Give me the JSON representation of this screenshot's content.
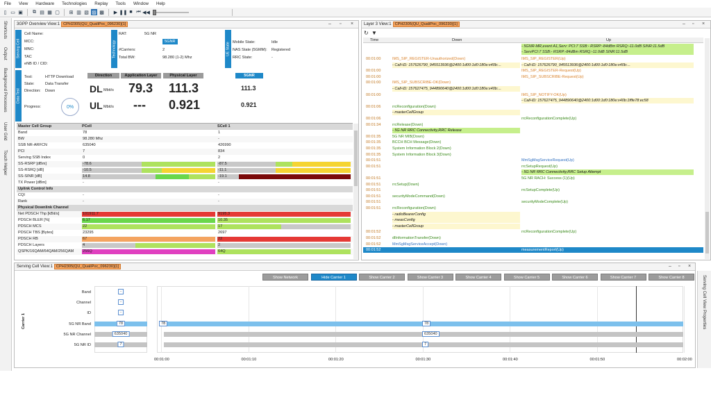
{
  "menu": [
    "File",
    "View",
    "Hardware",
    "Technologies",
    "Replay",
    "Tools",
    "Window",
    "Help"
  ],
  "side_tabs": [
    "Shortcuts",
    "Output",
    "Background Processes",
    "User Grid",
    "Touch Helper"
  ],
  "right_side_tab": "Serving Cell View Properties",
  "overview": {
    "title": "3GPP Overview View:1",
    "tag": "CPH2305(QU_QualiPoc_096230)[1]",
    "bands": {
      "serving_cell": "Serving Cell",
      "technology": "Technology",
      "ue_state": "UE State",
      "data_test": "Data Test"
    },
    "cell_labels": [
      "Cell Name:",
      "MCC:",
      "MNC:",
      "TAC",
      "eNB ID / CID:"
    ],
    "rat_label": "RAT:",
    "rat_value": "5G NR",
    "sgnr_badge": "5GNR",
    "carriers_label": "#Carriers:",
    "carriers_value": "2",
    "bw_label": "Total BW:",
    "bw_value": "98.280 (1-2) Mhz",
    "mobile_label": "Mobile State:",
    "mobile_value": "Idle",
    "nas_label": "NAS State (5GMM):",
    "nas_value": "Registered",
    "rrc_label": "RRC State:",
    "rrc_value": "-",
    "test_label": "Test:",
    "test_value": "HTTP Download",
    "state_label": "State:",
    "state_value": "Data Transfer",
    "direction_label": "Direction:",
    "direction_value": "Down",
    "progress_label": "Progress:",
    "progress_value": "0%",
    "col_direction": "Direction",
    "col_app": "Application Layer",
    "col_phy": "Physical Layer",
    "col_5gnr": "5GNR",
    "dl": "DL",
    "ul": "UL",
    "unit": "Mbit/s",
    "dl_app": "79.3",
    "dl_phy": "111.3",
    "dl_5gnr": "111.3",
    "ul_app": "---",
    "ul_phy": "0.921",
    "ul_5gnr": "0.921"
  },
  "table": {
    "col_group": "Master Cell Group",
    "col_pcell": "PCell",
    "col_scell": "SCell 1",
    "rows": [
      {
        "label": "Band",
        "p": "78",
        "s": "1"
      },
      {
        "label": "BW",
        "p": "98.280 Mhz",
        "s": "-"
      },
      {
        "label": "SSB NR-ARFCN",
        "p": "635040",
        "s": "426990"
      },
      {
        "label": "PCI",
        "p": "7",
        "s": "834"
      },
      {
        "label": "Serving SSB Index",
        "p": "0",
        "s": "2"
      },
      {
        "label": "SS-RSRP [dBm]",
        "p": "-78.6",
        "s": "-87.5"
      },
      {
        "label": "SS-RSRQ [dB]",
        "p": "-10.5",
        "s": "-11.1"
      },
      {
        "label": "SS-SINR [dB]",
        "p": "14.8",
        "s": "-19.1"
      },
      {
        "label": "TX Power [dBm]",
        "p": "-",
        "s": "-"
      },
      {
        "label": "Uplink Control Info",
        "section": true
      },
      {
        "label": "CQI",
        "p": "-",
        "s": "-"
      },
      {
        "label": "Rank",
        "p": "-",
        "s": "-"
      },
      {
        "label": "Physical Downlink Channel",
        "section": true
      },
      {
        "label": "Net PDSCH Thp [kBit/s]",
        "p": "101911.7",
        "s": "9195.3"
      },
      {
        "label": "PDSCH BLER [%]",
        "p": "6.17",
        "s": "10.35"
      },
      {
        "label": "PDSCH MCS",
        "p": "22",
        "s": "17"
      },
      {
        "label": "PDSCH TBS [Bytes]",
        "p": "23295",
        "s": "2697"
      },
      {
        "label": "PDSCH RB",
        "p": "67",
        "s": "22"
      },
      {
        "label": "PDSCH Layers",
        "p": "4",
        "s": "2"
      },
      {
        "label": "QSPK/16QAM/64QAM/256QAM",
        "p": "256Q",
        "s": "64Q"
      }
    ]
  },
  "layer3": {
    "title": "Layer 3 View:1",
    "tag": "CPH2305(QU_QualiPoc_096230)[1]",
    "col_time": "Time",
    "col_down": "Down",
    "col_up": "Up",
    "top_up_1": "- 5GNR-MR,event A1,Serv: PCI:7 SSB:- RSRP:-84dBm RSRQ:-11.0dB SINR:11.5dB",
    "top_up_2": "- ServPCI:7 SSB:- RSRP:-84dBm RSRQ:-11.0dB SINR:11.5dB",
    "rows": [
      {
        "time": "00:01:00",
        "down": "IMS_SIP_REGISTER-Unauthorized(Down)",
        "up": "IMS_SIP_REGISTER(Up)",
        "kind": "ims"
      },
      {
        "time": "",
        "down": "- Call-ID: 157626790_945513936@2400:1d00:1d0:180e:x40b:...",
        "up": "- Call-ID: 157626790_945513936@2400:1d00:1d0:180e:x40b:...",
        "kind": "ims-detail"
      },
      {
        "time": "00:01:00",
        "down": "",
        "up": "IMS_SIP_REGISTER-Request(Up)",
        "kind": "ims"
      },
      {
        "time": "00:01:00",
        "down": "",
        "up": "IMS_SIP_SUBSCRIBE-Request(Up)",
        "kind": "ims"
      },
      {
        "time": "00:01:00",
        "down": "IMS_SIP_SUBSCRIBE-OK(Down)",
        "up": "",
        "kind": "ims"
      },
      {
        "time": "",
        "down": "- Call-ID: 157627475_944890640@2400:1d00:1d0:180e:x40b:...",
        "up": "",
        "kind": "ims-detail"
      },
      {
        "time": "00:01:00",
        "down": "",
        "up": "IMS_SIP_NOTIFY-OK(Up)",
        "kind": "ims"
      },
      {
        "time": "",
        "down": "",
        "up": "- Call-ID: 157627475_944890640@2400:1d00:1d0:180e:x40b:1fffe78:ec58",
        "kind": "ims-detail"
      },
      {
        "time": "00:01:06",
        "down": "rrcReconfiguration(Down)",
        "up": "",
        "kind": "rrc"
      },
      {
        "time": "",
        "down": "- masterCellGroup",
        "up": "",
        "kind": "detail"
      },
      {
        "time": "00:01:06",
        "down": "",
        "up": "rrcReconfigurationComplete(Up)",
        "kind": "rrc"
      },
      {
        "time": "00:01:34",
        "down": "rrcRelease(Down)",
        "up": "",
        "kind": "rrc"
      },
      {
        "time": "",
        "down": "- 5G NR RRC Connectivity,RRC Release",
        "up": "",
        "kind": "green"
      },
      {
        "time": "00:01:35",
        "down": "5G NR MIB(Down)",
        "up": "",
        "kind": "rrc"
      },
      {
        "time": "00:01:35",
        "down": "BCCH BCH Message(Down)",
        "up": "",
        "kind": "rrc"
      },
      {
        "time": "00:01:35",
        "down": "System Information Block 2(Down)",
        "up": "",
        "kind": "rrc"
      },
      {
        "time": "00:01:35",
        "down": "System Information Block 3(Down)",
        "up": "",
        "kind": "rrc"
      },
      {
        "time": "00:01:51",
        "down": "",
        "up": "MmSgMsgServiceRequest(Up)",
        "kind": "blue"
      },
      {
        "time": "00:01:51",
        "down": "",
        "up": "rrcSetupRequest(Up)",
        "kind": "rrc"
      },
      {
        "time": "",
        "down": "",
        "up": "- 5G NR RRC Connectivity,RRC Setup Attempt",
        "kind": "green"
      },
      {
        "time": "00:01:51",
        "down": "",
        "up": "5G NR RACH: Success (1)(Up)",
        "kind": "rrc"
      },
      {
        "time": "00:01:51",
        "down": "rrcSetup(Down)",
        "up": "",
        "kind": "rrc"
      },
      {
        "time": "00:01:51",
        "down": "",
        "up": "rrcSetupComplete(Up)",
        "kind": "rrc"
      },
      {
        "time": "00:01:51",
        "down": "securityModeCommand(Down)",
        "up": "",
        "kind": "rrc"
      },
      {
        "time": "00:01:51",
        "down": "",
        "up": "securityModeComplete(Up)",
        "kind": "rrc"
      },
      {
        "time": "00:01:51",
        "down": "rrcReconfiguration(Down)",
        "up": "",
        "kind": "rrc"
      },
      {
        "time": "",
        "down": "- radioBearerConfig",
        "up": "",
        "kind": "detail"
      },
      {
        "time": "",
        "down": "- measConfig",
        "up": "",
        "kind": "detail"
      },
      {
        "time": "",
        "down": "- masterCellGroup",
        "up": "",
        "kind": "detail"
      },
      {
        "time": "00:01:52",
        "down": "",
        "up": "rrcReconfigurationComplete(Up)",
        "kind": "rrc"
      },
      {
        "time": "00:01:52",
        "down": "dlInformationTransfer(Down)",
        "up": "",
        "kind": "rrc"
      },
      {
        "time": "00:01:52",
        "down": "MmSgMsgServiceAccept(Down)",
        "up": "",
        "kind": "blue"
      },
      {
        "time": "00:01:52",
        "down": "",
        "up": "measurementReport(Up)",
        "kind": "selected"
      }
    ]
  },
  "serving": {
    "title": "Serving Cell View:1",
    "tag": "CPH2305(QU_QualiPoc_096230)[1]",
    "buttons": [
      "Show Network",
      "Hide Carrier 1",
      "Show Carrier 2",
      "Show Carrier 3",
      "Show Carrier 4",
      "Show Carrier 5",
      "Show Carrier 6",
      "Show Carrier 7",
      "Show Carrier 8"
    ],
    "active_button": 1,
    "carrier_label": "Carrier 1",
    "labels": [
      "Band",
      "Channel",
      "ID",
      "5G NR Band",
      "5G NR Channel",
      "5G NR ID"
    ],
    "left_values": [
      "-",
      "-",
      "-",
      "78",
      "635040",
      "7"
    ],
    "timeline_values": [
      "78",
      "635040",
      "7"
    ],
    "timeline_start": "78",
    "x_ticks": [
      "00:01:00",
      "00:01:10",
      "00:01:20",
      "00:01:30",
      "00:01:40",
      "00:01:50",
      "00:02:00"
    ]
  },
  "colors": {
    "accent": "#1e88c8",
    "orange": "#f7a35c",
    "green": "#c6ef8c",
    "selected": "#1e88c8"
  }
}
